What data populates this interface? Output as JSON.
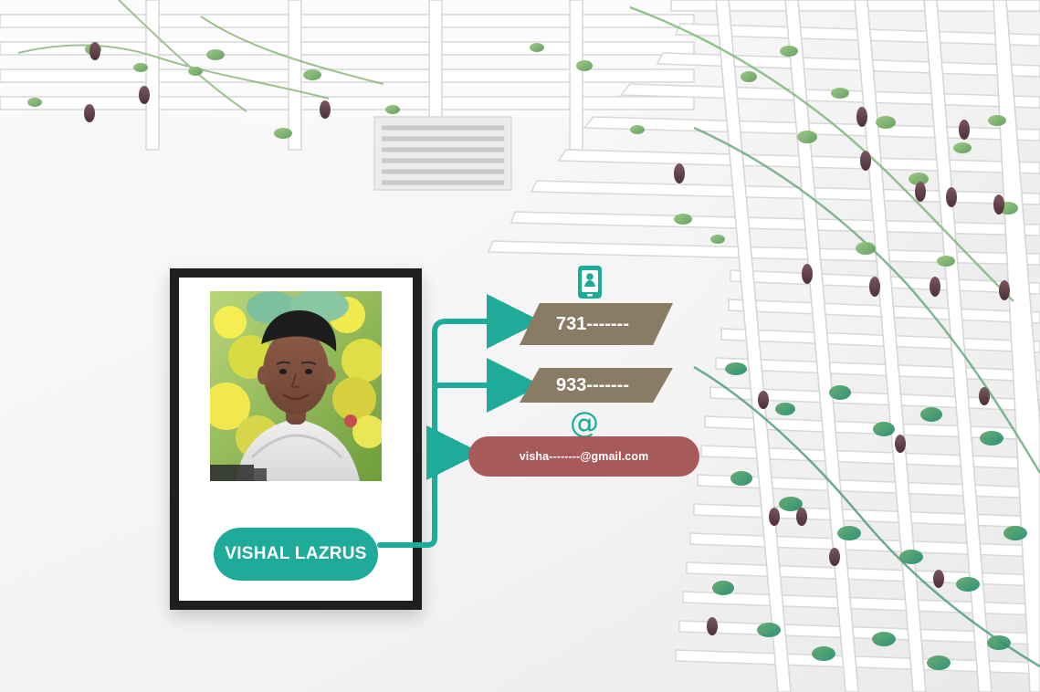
{
  "profile": {
    "name": "VISHAL LAZRUS"
  },
  "contacts": {
    "phone_1": "731-------",
    "phone_2": "933-------",
    "email": "visha--------@gmail.com"
  },
  "icons": {
    "phone": "mobile-contact-icon",
    "email": "at-symbol-icon"
  },
  "colors": {
    "accent": "#1eab9a",
    "phone_card": "#8a7c64",
    "email_card": "#a8595a",
    "frame": "#1f1f1f"
  }
}
